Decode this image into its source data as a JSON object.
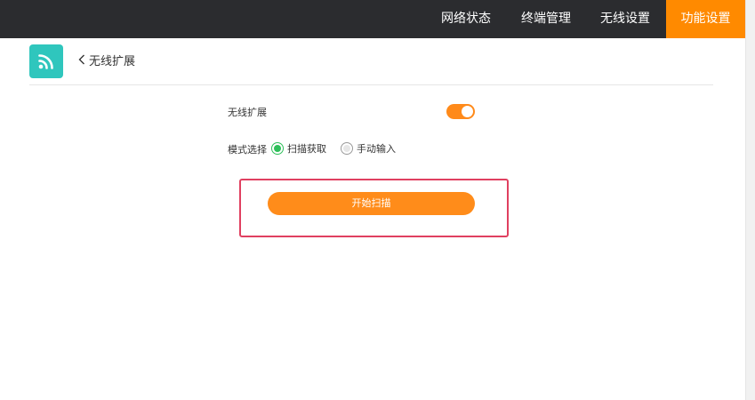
{
  "nav": {
    "items": [
      {
        "label": "网络状态",
        "active": false
      },
      {
        "label": "终端管理",
        "active": false
      },
      {
        "label": "无线设置",
        "active": false
      },
      {
        "label": "功能设置",
        "active": true
      }
    ]
  },
  "header": {
    "icon": "wifi-feed-icon",
    "back_label": "无线扩展"
  },
  "form": {
    "extension_label": "无线扩展",
    "extension_enabled": true,
    "mode_label": "模式选择",
    "mode_options": [
      {
        "label": "扫描获取",
        "checked": true
      },
      {
        "label": "手动输入",
        "checked": false
      }
    ],
    "scan_button": "开始扫描"
  },
  "colors": {
    "topbar": "#2b2c2f",
    "accent": "#ff8a00",
    "icon_bg": "#2fc6bd",
    "radio_checked": "#2fbf5a",
    "highlight": "#e04060"
  }
}
